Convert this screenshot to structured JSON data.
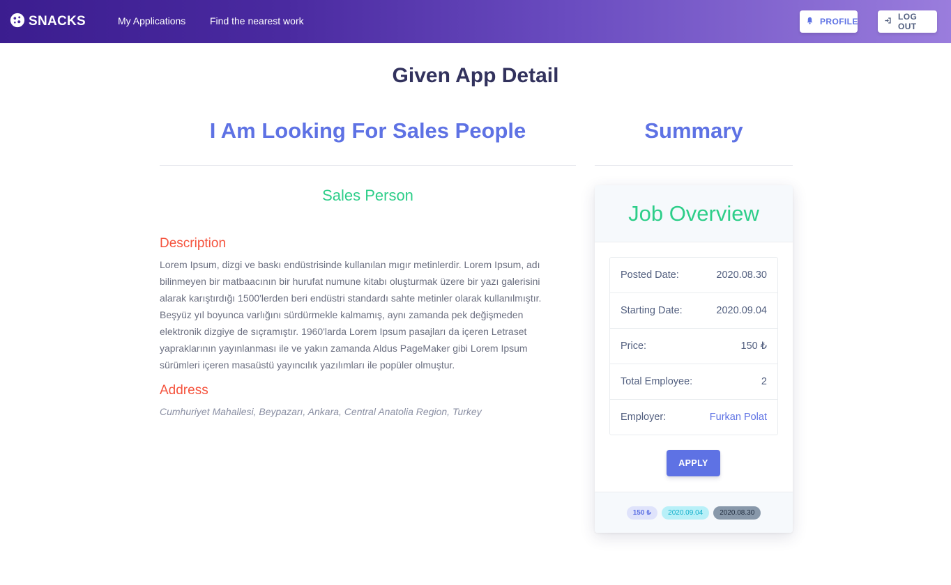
{
  "navbar": {
    "brand": "SNACKS",
    "links": [
      "My Applications",
      "Find the nearest work"
    ],
    "profile_label": "PROFILE",
    "logout_label": "LOG OUT"
  },
  "page": {
    "title": "Given App Detail",
    "left_title": "I Am Looking For Sales People",
    "right_title": "Summary"
  },
  "job": {
    "name": "Sales Person",
    "description_heading": "Description",
    "description": "Lorem Ipsum, dizgi ve baskı endüstrisinde kullanılan mıgır metinlerdir. Lorem Ipsum, adı bilinmeyen bir matbaacının bir hurufat numune kitabı oluşturmak üzere bir yazı galerisini alarak karıştırdığı 1500'lerden beri endüstri standardı sahte metinler olarak kullanılmıştır. Beşyüz yıl boyunca varlığını sürdürmekle kalmamış, aynı zamanda pek değişmeden elektronik dizgiye de sıçramıştır. 1960'larda Lorem Ipsum pasajları da içeren Letraset yapraklarının yayınlanması ile ve yakın zamanda Aldus PageMaker gibi Lorem Ipsum sürümleri içeren masaüstü yayıncılık yazılımları ile popüler olmuştur.",
    "address_heading": "Address",
    "address": "Cumhuriyet Mahallesi, Beypazarı, Ankara, Central Anatolia Region, Turkey"
  },
  "overview": {
    "title": "Job Overview",
    "rows": [
      {
        "label": "Posted Date:",
        "value": "2020.08.30"
      },
      {
        "label": "Starting Date:",
        "value": "2020.09.04"
      },
      {
        "label": "Price:",
        "value": "150 ₺"
      },
      {
        "label": "Total Employee:",
        "value": "2"
      },
      {
        "label": "Employer:",
        "value": "Furkan Polat"
      }
    ],
    "apply_label": "APPLY",
    "badges": [
      "150 ₺",
      "2020.09.04",
      "2020.08.30"
    ]
  },
  "colors": {
    "primary": "#5e72e4",
    "success": "#2dce89",
    "danger": "#f5533d",
    "nav_start": "#3b1d8f",
    "nav_end": "#9a7ddd"
  },
  "icons": {
    "brand": "cookie-logo-icon",
    "profile": "bell-icon",
    "logout": "sign-out-icon"
  }
}
